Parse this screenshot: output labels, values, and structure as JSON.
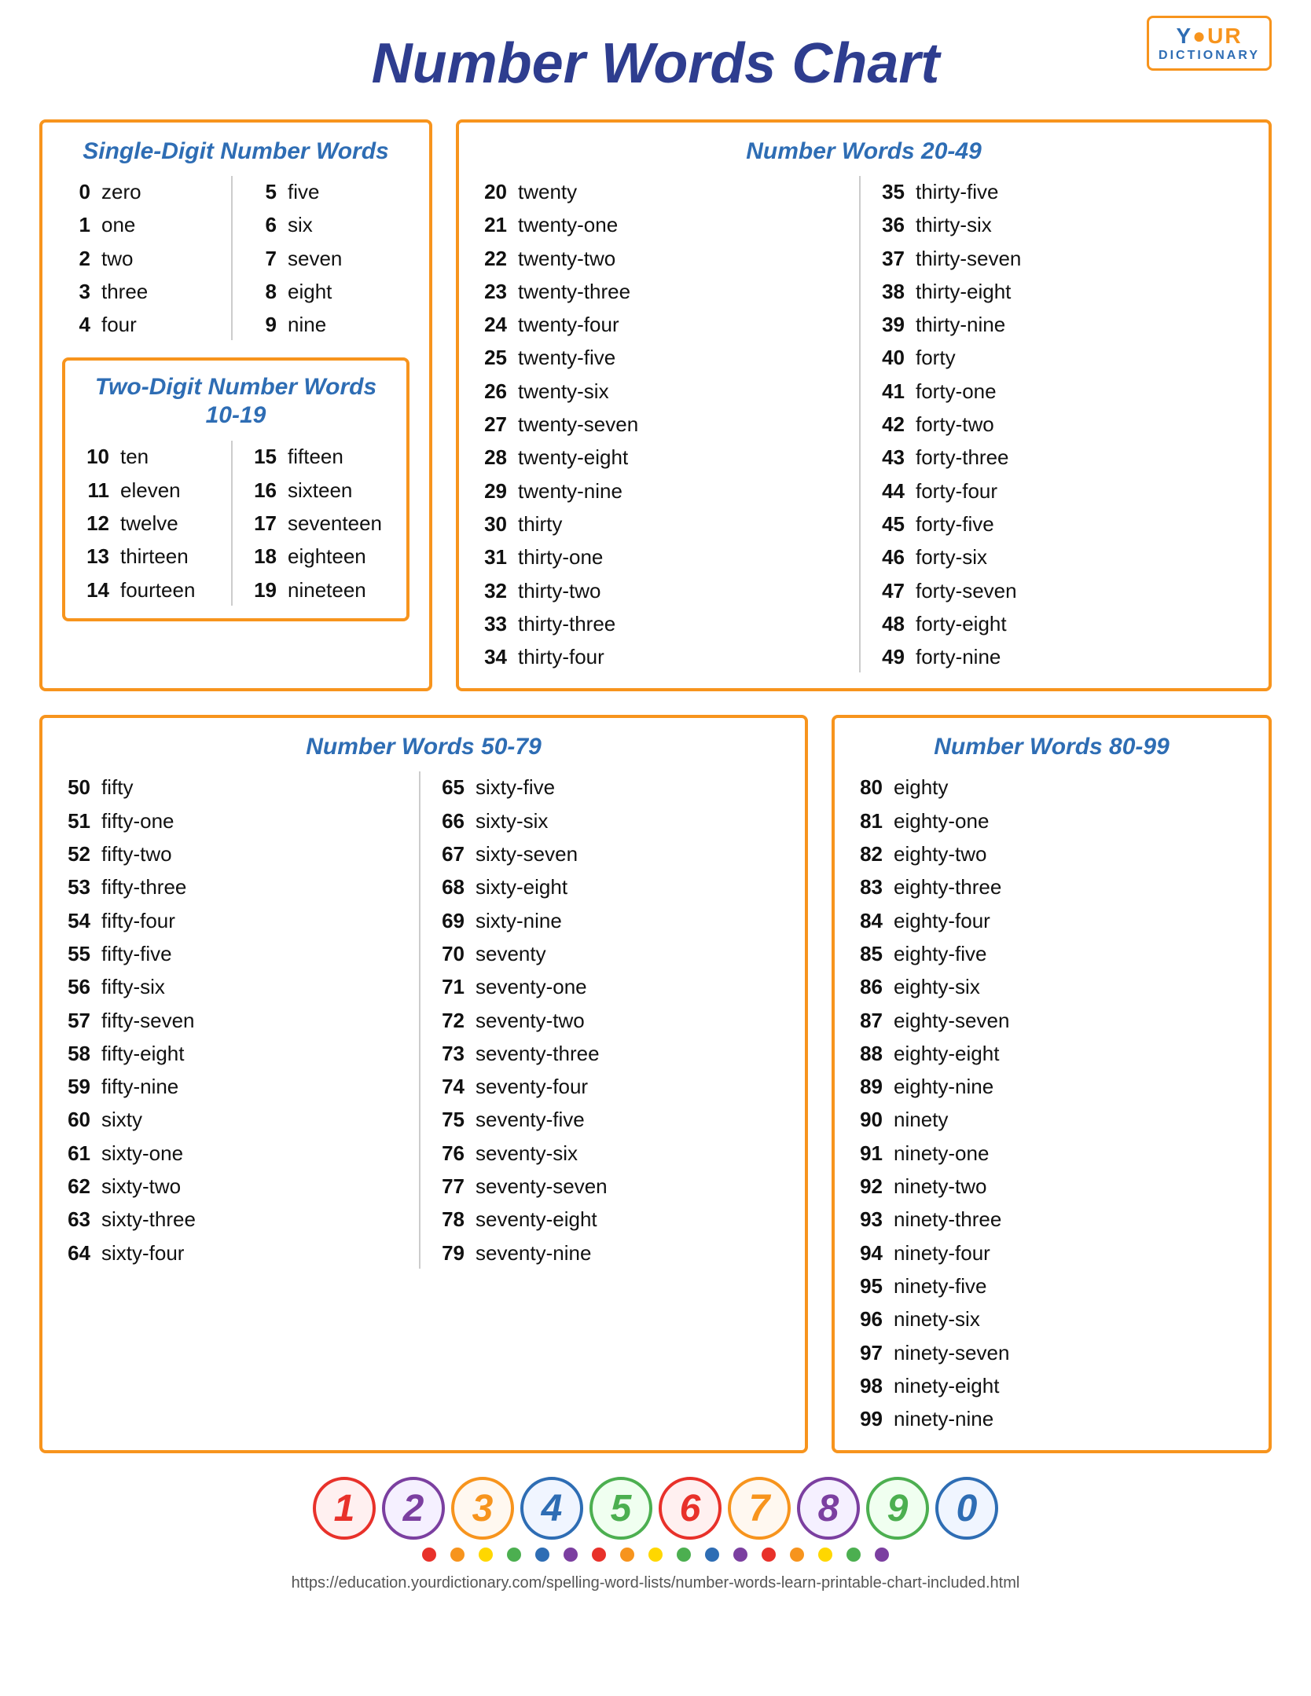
{
  "logo": {
    "your": "Y●UR",
    "dictionary": "DICTIONARY"
  },
  "title": "Number Words Chart",
  "boxes": {
    "single_digit": {
      "title": "Single-Digit Number Words",
      "col1": [
        {
          "num": "0",
          "word": "zero"
        },
        {
          "num": "1",
          "word": "one"
        },
        {
          "num": "2",
          "word": "two"
        },
        {
          "num": "3",
          "word": "three"
        },
        {
          "num": "4",
          "word": "four"
        }
      ],
      "col2": [
        {
          "num": "5",
          "word": "five"
        },
        {
          "num": "6",
          "word": "six"
        },
        {
          "num": "7",
          "word": "seven"
        },
        {
          "num": "8",
          "word": "eight"
        },
        {
          "num": "9",
          "word": "nine"
        }
      ]
    },
    "two_digit": {
      "title_line1": "Two-Digit Number Words",
      "title_line2": "10-19",
      "col1": [
        {
          "num": "10",
          "word": "ten"
        },
        {
          "num": "11",
          "word": "eleven"
        },
        {
          "num": "12",
          "word": "twelve"
        },
        {
          "num": "13",
          "word": "thirteen"
        },
        {
          "num": "14",
          "word": "fourteen"
        }
      ],
      "col2": [
        {
          "num": "15",
          "word": "fifteen"
        },
        {
          "num": "16",
          "word": "sixteen"
        },
        {
          "num": "17",
          "word": "seventeen"
        },
        {
          "num": "18",
          "word": "eighteen"
        },
        {
          "num": "19",
          "word": "nineteen"
        }
      ]
    },
    "twenty_to_49": {
      "title": "Number Words 20-49",
      "col1": [
        {
          "num": "20",
          "word": "twenty"
        },
        {
          "num": "21",
          "word": "twenty-one"
        },
        {
          "num": "22",
          "word": "twenty-two"
        },
        {
          "num": "23",
          "word": "twenty-three"
        },
        {
          "num": "24",
          "word": "twenty-four"
        },
        {
          "num": "25",
          "word": "twenty-five"
        },
        {
          "num": "26",
          "word": "twenty-six"
        },
        {
          "num": "27",
          "word": "twenty-seven"
        },
        {
          "num": "28",
          "word": "twenty-eight"
        },
        {
          "num": "29",
          "word": "twenty-nine"
        },
        {
          "num": "30",
          "word": "thirty"
        },
        {
          "num": "31",
          "word": "thirty-one"
        },
        {
          "num": "32",
          "word": "thirty-two"
        },
        {
          "num": "33",
          "word": "thirty-three"
        },
        {
          "num": "34",
          "word": "thirty-four"
        }
      ],
      "col2": [
        {
          "num": "35",
          "word": "thirty-five"
        },
        {
          "num": "36",
          "word": "thirty-six"
        },
        {
          "num": "37",
          "word": "thirty-seven"
        },
        {
          "num": "38",
          "word": "thirty-eight"
        },
        {
          "num": "39",
          "word": "thirty-nine"
        },
        {
          "num": "40",
          "word": "forty"
        },
        {
          "num": "41",
          "word": "forty-one"
        },
        {
          "num": "42",
          "word": "forty-two"
        },
        {
          "num": "43",
          "word": "forty-three"
        },
        {
          "num": "44",
          "word": "forty-four"
        },
        {
          "num": "45",
          "word": "forty-five"
        },
        {
          "num": "46",
          "word": "forty-six"
        },
        {
          "num": "47",
          "word": "forty-seven"
        },
        {
          "num": "48",
          "word": "forty-eight"
        },
        {
          "num": "49",
          "word": "forty-nine"
        }
      ]
    },
    "fifty_to_79": {
      "title": "Number Words 50-79",
      "col1": [
        {
          "num": "50",
          "word": "fifty"
        },
        {
          "num": "51",
          "word": "fifty-one"
        },
        {
          "num": "52",
          "word": "fifty-two"
        },
        {
          "num": "53",
          "word": "fifty-three"
        },
        {
          "num": "54",
          "word": "fifty-four"
        },
        {
          "num": "55",
          "word": "fifty-five"
        },
        {
          "num": "56",
          "word": "fifty-six"
        },
        {
          "num": "57",
          "word": "fifty-seven"
        },
        {
          "num": "58",
          "word": "fifty-eight"
        },
        {
          "num": "59",
          "word": "fifty-nine"
        },
        {
          "num": "60",
          "word": "sixty"
        },
        {
          "num": "61",
          "word": "sixty-one"
        },
        {
          "num": "62",
          "word": "sixty-two"
        },
        {
          "num": "63",
          "word": "sixty-three"
        },
        {
          "num": "64",
          "word": "sixty-four"
        }
      ],
      "col2": [
        {
          "num": "65",
          "word": "sixty-five"
        },
        {
          "num": "66",
          "word": "sixty-six"
        },
        {
          "num": "67",
          "word": "sixty-seven"
        },
        {
          "num": "68",
          "word": "sixty-eight"
        },
        {
          "num": "69",
          "word": "sixty-nine"
        },
        {
          "num": "70",
          "word": "seventy"
        },
        {
          "num": "71",
          "word": "seventy-one"
        },
        {
          "num": "72",
          "word": "seventy-two"
        },
        {
          "num": "73",
          "word": "seventy-three"
        },
        {
          "num": "74",
          "word": "seventy-four"
        },
        {
          "num": "75",
          "word": "seventy-five"
        },
        {
          "num": "76",
          "word": "seventy-six"
        },
        {
          "num": "77",
          "word": "seventy-seven"
        },
        {
          "num": "78",
          "word": "seventy-eight"
        },
        {
          "num": "79",
          "word": "seventy-nine"
        }
      ]
    },
    "eighty_to_99": {
      "title": "Number Words 80-99",
      "col1": [
        {
          "num": "80",
          "word": "eighty"
        },
        {
          "num": "81",
          "word": "eighty-one"
        },
        {
          "num": "82",
          "word": "eighty-two"
        },
        {
          "num": "83",
          "word": "eighty-three"
        },
        {
          "num": "84",
          "word": "eighty-four"
        },
        {
          "num": "85",
          "word": "eighty-five"
        },
        {
          "num": "86",
          "word": "eighty-six"
        },
        {
          "num": "87",
          "word": "eighty-seven"
        },
        {
          "num": "88",
          "word": "eighty-eight"
        },
        {
          "num": "89",
          "word": "eighty-nine"
        },
        {
          "num": "90",
          "word": "ninety"
        },
        {
          "num": "91",
          "word": "ninety-one"
        },
        {
          "num": "92",
          "word": "ninety-two"
        },
        {
          "num": "93",
          "word": "ninety-three"
        },
        {
          "num": "94",
          "word": "ninety-four"
        },
        {
          "num": "95",
          "word": "ninety-five"
        },
        {
          "num": "96",
          "word": "ninety-six"
        },
        {
          "num": "97",
          "word": "ninety-seven"
        },
        {
          "num": "98",
          "word": "ninety-eight"
        },
        {
          "num": "99",
          "word": "ninety-nine"
        }
      ]
    }
  },
  "decorative_numbers": [
    "1",
    "2",
    "3",
    "4",
    "5",
    "6",
    "7",
    "8",
    "9",
    "0"
  ],
  "dots_colors": [
    "#e8312a",
    "#f7941d",
    "#e8312a",
    "#f7941d",
    "#2e6db4",
    "#4caf50",
    "#7b3fa0",
    "#f7941d",
    "#e8312a",
    "#4caf50",
    "#2e6db4",
    "#7b3fa0",
    "#e8312a",
    "#f7941d",
    "#2e6db4",
    "#4caf50",
    "#7b3fa0"
  ],
  "footer_url": "https://education.yourdictionary.com/spelling-word-lists/number-words-learn-printable-chart-included.html"
}
